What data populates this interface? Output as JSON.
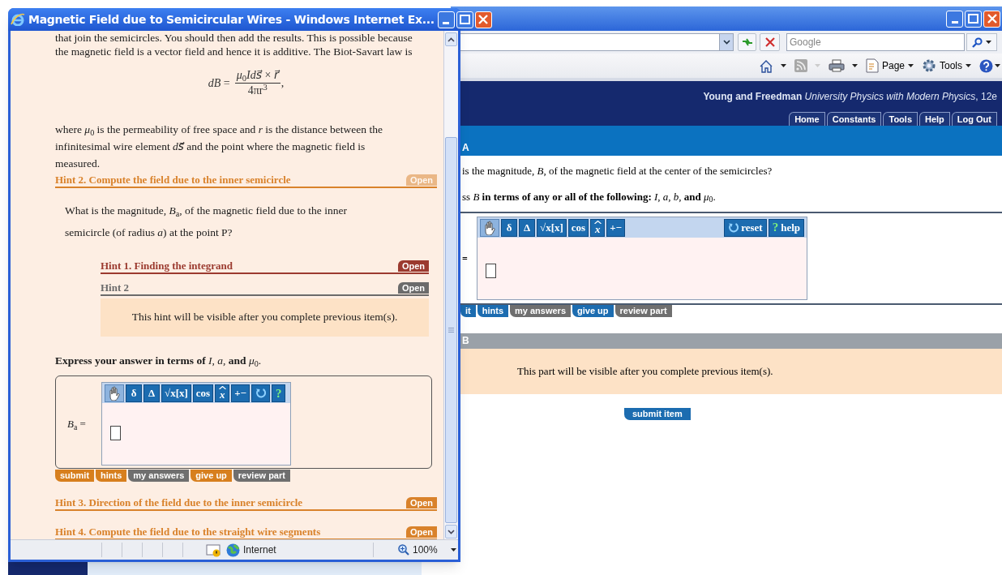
{
  "main_window": {
    "search": {
      "placeholder": "Google"
    },
    "command_bar": [
      {
        "kind": "home"
      },
      {
        "kind": "feed"
      },
      {
        "kind": "print"
      },
      {
        "kind": "page",
        "label": "Page"
      },
      {
        "kind": "tools",
        "label": "Tools"
      },
      {
        "kind": "help"
      }
    ],
    "header": {
      "authors": "Young and Freedman",
      "book": "University Physics with Modern Physics",
      "edition": ", 12e"
    },
    "tabs": [
      {
        "label": "Home"
      },
      {
        "label": "Constants"
      },
      {
        "label": "Tools"
      },
      {
        "label": "Help"
      },
      {
        "label": "Log Out"
      }
    ],
    "part_a": {
      "letter": "A",
      "question": "is the magnitude, *B*, of the magnetic field at the center of the semicircles?",
      "instruction": "ss *B* **in terms of any or all of the following:** *I*, *a*, *b*, **and** *μ*$_{0}$.",
      "equals": "=",
      "tools": [
        {
          "kind": "hand"
        },
        {
          "kind": "text",
          "label": "δ"
        },
        {
          "kind": "text",
          "label": "Δ"
        },
        {
          "kind": "text",
          "label": "√x[x]"
        },
        {
          "kind": "text",
          "label": "cos"
        },
        {
          "kind": "hat",
          "label": "x"
        },
        {
          "kind": "text",
          "label": "+−"
        }
      ],
      "end_tools": [
        {
          "kind": "reset",
          "label": "reset"
        },
        {
          "kind": "help",
          "glyph": "?",
          "label": "help"
        }
      ],
      "actions": [
        {
          "label": "it",
          "disabled": false
        },
        {
          "label": "hints",
          "disabled": false
        },
        {
          "label": "my answers",
          "disabled": true
        },
        {
          "label": "give up",
          "disabled": false
        },
        {
          "label": "review part",
          "disabled": true
        }
      ]
    },
    "part_b": {
      "letter": "B",
      "message": "This part will be visible after you complete previous item(s)."
    },
    "submit": "submit item"
  },
  "popup": {
    "title": "Magnetic Field due to Semicircular Wires - Windows Internet Ex...",
    "intro": "that join the semicircles. You should then add the results. This is possible because the magnetic field is a vector field and hence it is additive. The Biot-Savart law is",
    "equation": {
      "lhs": "*dB* =",
      "numerator": "*μ*$_{0}$*Ids⃗* × *r⃗*",
      "denominator": "4πr$^{3}$",
      "trail": ","
    },
    "explanation": "where *μ*$_{0}$ is the permeability of free space and *r* is the distance between the infinitesimal wire element *ds⃗* and the point where the magnetic field is measured.",
    "hints": [
      {
        "title": "Hint 2. Compute the field due to the inner semicircle",
        "button": "Open",
        "color": "#d9822b",
        "expanded": true,
        "question": "What is the magnitude, *B*$_{a}$, of the magnetic field due to the inner semicircle (of radius *a*) at the point P?",
        "subhints": [
          {
            "title": "Hint 1. Finding the integrand",
            "button": "Open",
            "color": "#9b3a2f"
          },
          {
            "title": "Hint 2",
            "button": "Open",
            "color": "#6b6b6b",
            "message": "This hint will be visible after you complete previous item(s)."
          }
        ],
        "instruction": "**Express your answer in terms of** *I*, *a*, **and** *μ*$_{0}$.",
        "answer_label": "*B*$_{a}$ =",
        "tools": [
          {
            "kind": "hand"
          },
          {
            "kind": "text",
            "label": "δ"
          },
          {
            "kind": "text",
            "label": "Δ"
          },
          {
            "kind": "text",
            "label": "√x[x]"
          },
          {
            "kind": "text",
            "label": "cos"
          },
          {
            "kind": "hat",
            "label": "x"
          },
          {
            "kind": "text",
            "label": "+−"
          },
          {
            "kind": "reset"
          },
          {
            "kind": "help",
            "glyph": "?"
          }
        ],
        "actions": [
          {
            "label": "submit",
            "disabled": false
          },
          {
            "label": "hints",
            "disabled": false
          },
          {
            "label": "my answers",
            "disabled": true
          },
          {
            "label": "give up",
            "disabled": false
          },
          {
            "label": "review part",
            "disabled": true
          }
        ]
      },
      {
        "title": "Hint 3. Direction of the field due to the inner semicircle",
        "button": "Open",
        "color": "#d9822b",
        "expanded": false
      },
      {
        "title": "Hint 4. Compute the field due to the straight wire segments",
        "button": "Open",
        "color": "#d9822b",
        "expanded": false
      }
    ],
    "status": {
      "zone": "Internet",
      "zoom": "100%"
    }
  }
}
